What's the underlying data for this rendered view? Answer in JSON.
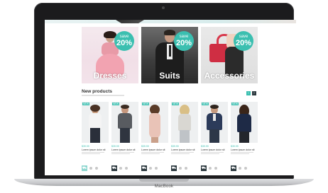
{
  "device": {
    "brand": "MacBook"
  },
  "promos": [
    {
      "title": "Dresses",
      "badge_top": "save",
      "badge_value": "20%"
    },
    {
      "title": "Suits",
      "badge_top": "save",
      "badge_value": "20%"
    },
    {
      "title": "Accessories",
      "badge_top": "save",
      "badge_value": "20%"
    }
  ],
  "section": {
    "title": "New products",
    "prev_icon": "chevron-left-icon",
    "next_icon": "chevron-right-icon"
  },
  "products": [
    {
      "tag": "NEW",
      "price": "$39.99",
      "name": "Lorem ipsum dolor sit"
    },
    {
      "tag": "NEW",
      "price": "$39.99",
      "name": "Lorem ipsum dolor sit"
    },
    {
      "tag": "NEW",
      "price": "$39.99",
      "name": "Lorem ipsum dolor sit"
    },
    {
      "tag": "NEW",
      "price": "$39.99",
      "name": "Lorem ipsum dolor sit"
    },
    {
      "tag": "NEW",
      "price": "$39.99",
      "name": "Lorem ipsum dolor sit"
    },
    {
      "tag": "NEW",
      "price": "$39.99",
      "name": "Lorem ipsum dolor sit"
    }
  ],
  "colors": {
    "accent": "#3bbfb0",
    "dark": "#2d3a40"
  }
}
